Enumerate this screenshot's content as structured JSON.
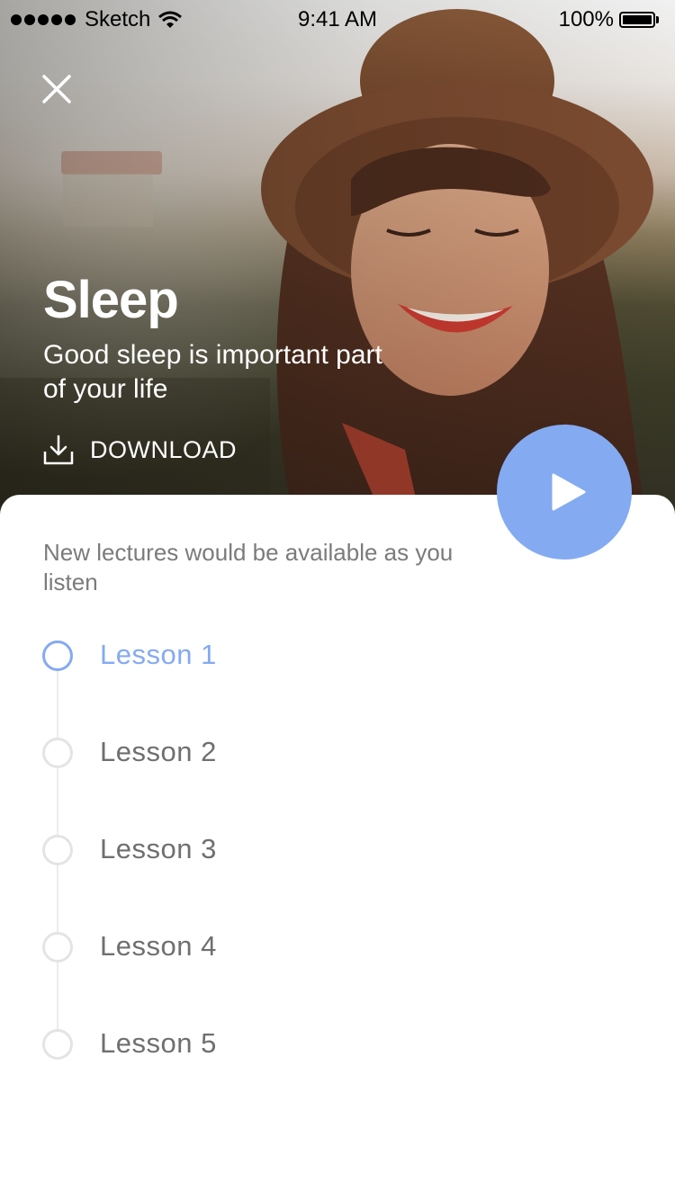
{
  "status_bar": {
    "carrier": "Sketch",
    "time": "9:41 AM",
    "battery": "100%"
  },
  "header": {
    "title": "Sleep",
    "subtitle": "Good sleep is important part of your life",
    "download_label": "DOWNLOAD"
  },
  "content": {
    "notice": "New lectures would be available as you listen",
    "lessons": [
      {
        "label": "Lesson 1",
        "active": true
      },
      {
        "label": "Lesson 2",
        "active": false
      },
      {
        "label": "Lesson 3",
        "active": false
      },
      {
        "label": "Lesson 4",
        "active": false
      },
      {
        "label": "Lesson 5",
        "active": false
      }
    ]
  },
  "colors": {
    "accent": "#84aaf2",
    "text_muted": "#6f6f6f",
    "timeline": "#ececec"
  },
  "icons": {
    "close": "close-icon",
    "download": "download-icon",
    "play": "play-icon",
    "wifi": "wifi-icon",
    "battery": "battery-icon"
  }
}
